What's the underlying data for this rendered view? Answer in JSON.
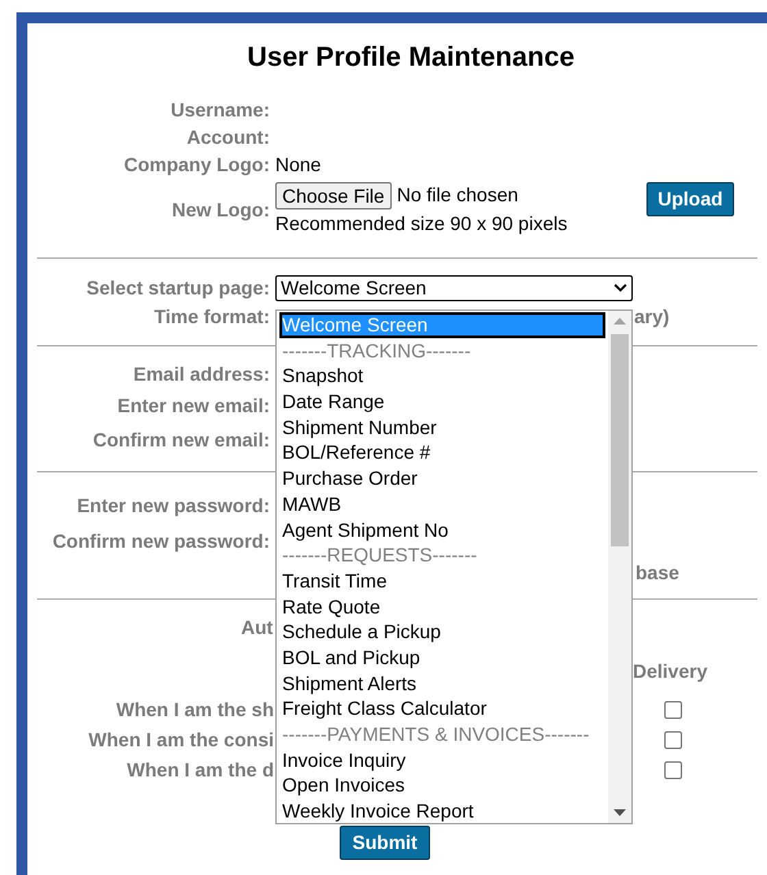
{
  "title": "User Profile Maintenance",
  "info_rows": [
    {
      "label": "Username:"
    },
    {
      "label": "Account:"
    },
    {
      "label": "Company Logo:",
      "value": "None"
    }
  ],
  "new_logo": {
    "label": "New Logo:",
    "file_button": "Choose File",
    "file_status": "No file chosen",
    "hint": "Recommended size 90 x 90 pixels",
    "upload_button": "Upload"
  },
  "startup": {
    "label": "Select startup page:",
    "value": "Welcome Screen",
    "expanded": true,
    "options": [
      {
        "label": "Welcome Screen",
        "kind": "option",
        "selected": true
      },
      {
        "label": "-------TRACKING-------",
        "kind": "group",
        "selected": false
      },
      {
        "label": "Snapshot",
        "kind": "option",
        "selected": false
      },
      {
        "label": "Date Range",
        "kind": "option",
        "selected": false
      },
      {
        "label": "Shipment Number",
        "kind": "option",
        "selected": false
      },
      {
        "label": "BOL/Reference #",
        "kind": "option",
        "selected": false
      },
      {
        "label": "Purchase Order",
        "kind": "option",
        "selected": false
      },
      {
        "label": "MAWB",
        "kind": "option",
        "selected": false
      },
      {
        "label": "Agent Shipment No",
        "kind": "option",
        "selected": false
      },
      {
        "label": "-------REQUESTS-------",
        "kind": "group",
        "selected": false
      },
      {
        "label": "Transit Time",
        "kind": "option",
        "selected": false
      },
      {
        "label": "Rate Quote",
        "kind": "option",
        "selected": false
      },
      {
        "label": "Schedule a Pickup",
        "kind": "option",
        "selected": false
      },
      {
        "label": "BOL and Pickup",
        "kind": "option",
        "selected": false
      },
      {
        "label": "Shipment Alerts",
        "kind": "option",
        "selected": false
      },
      {
        "label": "Freight Class Calculator",
        "kind": "option",
        "selected": false
      },
      {
        "label": "-------PAYMENTS & INVOICES-------",
        "kind": "group",
        "selected": false
      },
      {
        "label": "Invoice Inquiry",
        "kind": "option",
        "selected": false
      },
      {
        "label": "Open Invoices",
        "kind": "option",
        "selected": false
      },
      {
        "label": "Weekly Invoice Report",
        "kind": "option",
        "selected": false
      }
    ]
  },
  "time_format": {
    "label": "Time format:",
    "value_fragment": "ary)"
  },
  "email_fields": [
    "Email address:",
    "Enter new email:",
    "Confirm new email:"
  ],
  "password_fields": [
    "Enter new password:",
    "Confirm new password:"
  ],
  "password_note_fragment": "base",
  "alerts": {
    "heading_fragment": "Aut",
    "column_fragment": "Delivery",
    "rows": [
      {
        "label": "When I am the sh",
        "checked": false
      },
      {
        "label": "When I am the consi",
        "checked": false
      },
      {
        "label": "When I am the d",
        "checked": false
      }
    ]
  },
  "submit_button": "Submit"
}
